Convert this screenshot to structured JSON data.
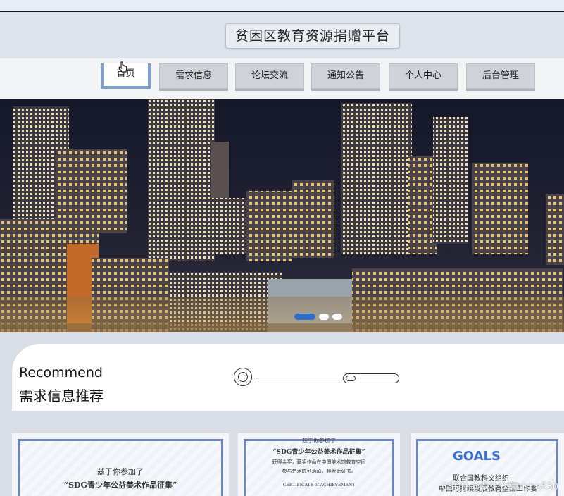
{
  "header": {
    "title": "贫困区教育资源捐赠平台"
  },
  "nav": {
    "items": [
      {
        "label": "首页",
        "active": true
      },
      {
        "label": "需求信息",
        "active": false
      },
      {
        "label": "论坛交流",
        "active": false
      },
      {
        "label": "通知公告",
        "active": false
      },
      {
        "label": "个人中心",
        "active": false
      },
      {
        "label": "后台管理",
        "active": false
      }
    ]
  },
  "banner": {
    "slide_count": 3,
    "active_slide": 1
  },
  "recommend": {
    "title_en": "Recommend",
    "title_zh": "需求信息推荐"
  },
  "cards": [
    {
      "line1": "兹于你参加了",
      "line2": "“SDG青少年公益美术作品征集”"
    },
    {
      "line1": "兹于你参加了",
      "line2": "“SDG青少年公益美术作品征集”",
      "line3": "获得金奖，获奖作品在中国美术馆教育空间",
      "line4": "参与艺术陈列活动，特发此证书。",
      "line5": "CERTIFICATE of ACHIEVEMENT"
    },
    {
      "line1": "GOALS",
      "line2": "联合国教科文组织",
      "line3": "中国可持续发展教育全国工作委"
    }
  ],
  "watermark": "CSDN @专注分享bishe530",
  "colors": {
    "accent": "#7fa1c9",
    "nav_bg": "#cfd3d9",
    "page_bg": "#d9dee6"
  }
}
